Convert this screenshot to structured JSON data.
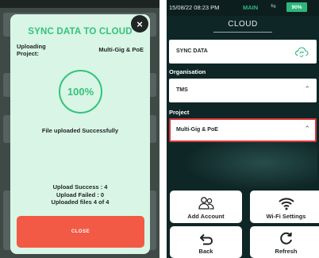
{
  "left": {
    "modal": {
      "title": "SYNC DATA TO CLOUD",
      "close_icon": "×",
      "uploading_label": "Uploading Project:",
      "project_name": "Multi-Gig & PoE",
      "progress": "100%",
      "message": "File uploaded Successfully",
      "stats": {
        "success": "Upload Success : 4",
        "failed": "Upload Failed : 0",
        "files": "Uploaded files 4 of 4"
      },
      "close_button": "CLOSE"
    }
  },
  "right": {
    "status_bar": {
      "time": "15/08/22 08:23 PM",
      "mode": "MAIN",
      "battery": "90%"
    },
    "title": "CLOUD",
    "sync_data": {
      "label": "SYNC DATA",
      "icon": "cloud-sync-icon"
    },
    "organisation": {
      "label": "Organisation",
      "value": "TMS"
    },
    "project": {
      "label": "Project",
      "value": "Multi-Gig & PoE"
    },
    "buttons": {
      "add_account": "Add Account",
      "wifi_settings": "Wi-Fi Settings",
      "back": "Back",
      "refresh": "Refresh"
    },
    "colors": {
      "accent_green": "#2fb67a",
      "close_red": "#f25a45",
      "selected_border": "#d9343a"
    }
  }
}
